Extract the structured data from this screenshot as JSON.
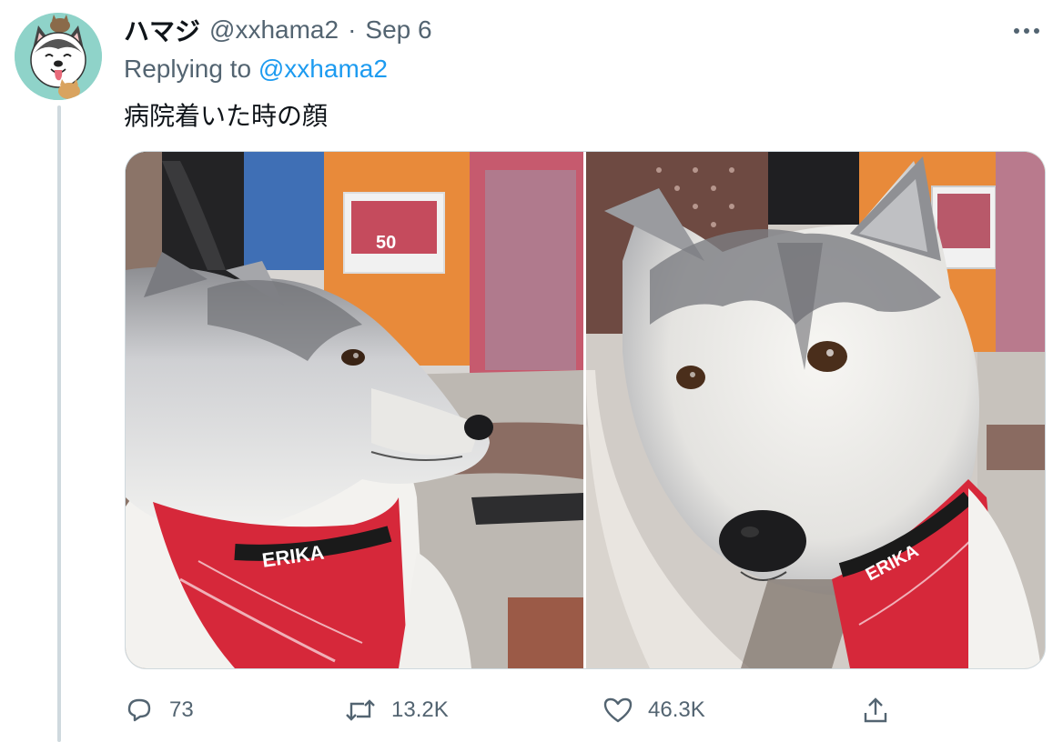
{
  "tweet": {
    "display_name": "ハマジ",
    "handle": "@xxhama2",
    "separator": "·",
    "date": "Sep 6",
    "reply_prefix": "Replying to",
    "reply_to": "@xxhama2",
    "text": "病院着いた時の顔",
    "more_icon": "more-dots-icon",
    "avatar_icon": "husky-cartoon-avatar"
  },
  "media": {
    "photos": [
      {
        "subject": "husky-in-car-side-profile"
      },
      {
        "subject": "husky-in-car-front-face"
      }
    ],
    "bandana_lettering_left": "ERIKA",
    "bandana_lettering_right": "ERIKA",
    "poster_number": "50"
  },
  "actions": {
    "reply": {
      "icon": "reply-bubble-icon",
      "count": "73"
    },
    "retweet": {
      "icon": "retweet-icon",
      "count": "13.2K"
    },
    "like": {
      "icon": "heart-icon",
      "count": "46.3K"
    },
    "share": {
      "icon": "share-upload-icon"
    }
  },
  "colors": {
    "text_primary": "#0f1419",
    "text_secondary": "#536471",
    "link": "#1d9bf0",
    "border": "#cfd9de"
  }
}
